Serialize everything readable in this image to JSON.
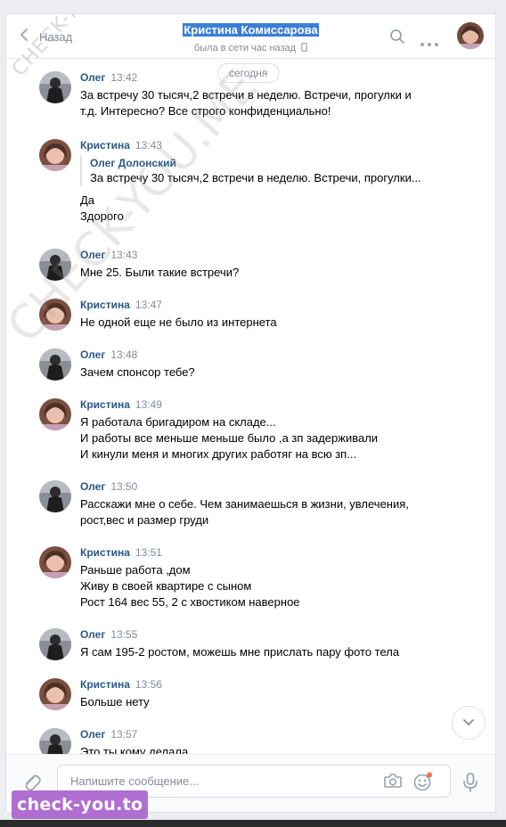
{
  "header": {
    "back_label": "Назад",
    "peer_name": "Кристина Комиссарова",
    "peer_status": "была в сети час назад"
  },
  "history": {
    "date_label": "сегодня",
    "messages": [
      {
        "author": "Олег",
        "time": "13:42",
        "avatar": "oleg",
        "lines": [
          "За встречу 30 тысяч,2 встречи в неделю. Встречи, прогулки и",
          "т.д. Интересно? Все строго конфиденциально!"
        ]
      },
      {
        "author": "Кристина",
        "time": "13:43",
        "avatar": "kristina",
        "quote": {
          "author": "Олег Долонский",
          "text": "За встречу 30 тысяч,2 встречи в неделю. Встречи, прогулки..."
        },
        "lines": [
          "Да",
          "Здорого"
        ]
      },
      {
        "author": "Олег",
        "time": "13:43",
        "avatar": "oleg",
        "lines": [
          "Мне 25. Были такие встречи?"
        ]
      },
      {
        "author": "Кристина",
        "time": "13:47",
        "avatar": "kristina",
        "lines": [
          "Не одной еще не было из интернета"
        ]
      },
      {
        "author": "Олег",
        "time": "13:48",
        "avatar": "oleg",
        "lines": [
          "Зачем спонсор тебе?"
        ]
      },
      {
        "author": "Кристина",
        "time": "13:49",
        "avatar": "kristina",
        "lines": [
          "Я работала бригадиром на складе...",
          "И работы все меньше меньше было ,а зп задерживали",
          "И кинули меня и многих других работяг на всю зп..."
        ]
      },
      {
        "author": "Олег",
        "time": "13:50",
        "avatar": "oleg",
        "lines": [
          "Расскажи мне о себе. Чем занимаешься в жизни, увлечения,",
          "рост,вес и размер груди"
        ]
      },
      {
        "author": "Кристина",
        "time": "13:51",
        "avatar": "kristina",
        "lines": [
          "Раньше работа ,дом",
          "Живу в своей квартире с сыном",
          "Рост 164 вес 55, 2 с хвостиком наверное"
        ]
      },
      {
        "author": "Олег",
        "time": "13:55",
        "avatar": "oleg",
        "lines": [
          "Я сам 195-2 ростом, можешь мне прислать пару фото тела"
        ]
      },
      {
        "author": "Кристина",
        "time": "13:56",
        "avatar": "kristina",
        "lines": [
          "Больше нету"
        ]
      },
      {
        "author": "Олег",
        "time": "13:57",
        "avatar": "oleg",
        "lines": [
          "Это ты кому делала"
        ]
      }
    ]
  },
  "composer": {
    "placeholder": "Напишите сообщение...",
    "value": ""
  },
  "watermarks": {
    "small": "CHECK-YOU.ME",
    "large": "CHECK-YOU.ME",
    "badge": "check-you.to"
  },
  "colors": {
    "accent": "#2a5885",
    "muted": "#818c99",
    "selection": "#3b7ed6",
    "badge": "#b06ed0"
  }
}
